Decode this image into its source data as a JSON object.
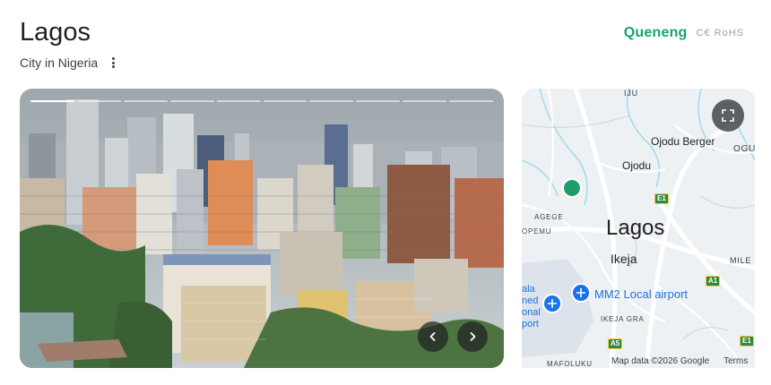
{
  "header": {
    "title": "Lagos",
    "subtitle": "City in Nigeria",
    "more_icon": "more-vert-icon"
  },
  "brand": {
    "name": "Queneng",
    "certifications": "C€ RoHS"
  },
  "photo": {
    "slide_count": 10,
    "active_slide": 1,
    "prev_icon": "chevron-left-icon",
    "next_icon": "chevron-right-icon"
  },
  "map": {
    "labels": {
      "iju": "IJU",
      "ojodu_berger": "Ojodu Berger",
      "ogu": "OGU",
      "ojodu": "Ojodu",
      "agege": "AGEGE",
      "opemu": "OPEMU",
      "lagos": "Lagos",
      "ikeja": "Ikeja",
      "mile": "MILE",
      "mm2": "MM2 Local airport",
      "ikeja_gra": "IKEJA GRA",
      "mafoluku": "MAFOLUKU",
      "left_partial_1": "ala",
      "left_partial_2": "ned",
      "left_partial_3": "onal",
      "left_partial_4": "port"
    },
    "road_badges": {
      "e1_top": "E1",
      "a1": "A1",
      "a5": "A5",
      "e1_bottom": "E1"
    },
    "attribution": "Map data ©2026 Google",
    "terms": "Terms",
    "expand_icon": "fullscreen-icon",
    "colors": {
      "water": "#a8daf0",
      "land": "#eef1f3",
      "airport": "#dde3ea",
      "road": "#ffffff",
      "accent_blue": "#1a73e8",
      "green_pin": "#1e9e6a"
    }
  }
}
